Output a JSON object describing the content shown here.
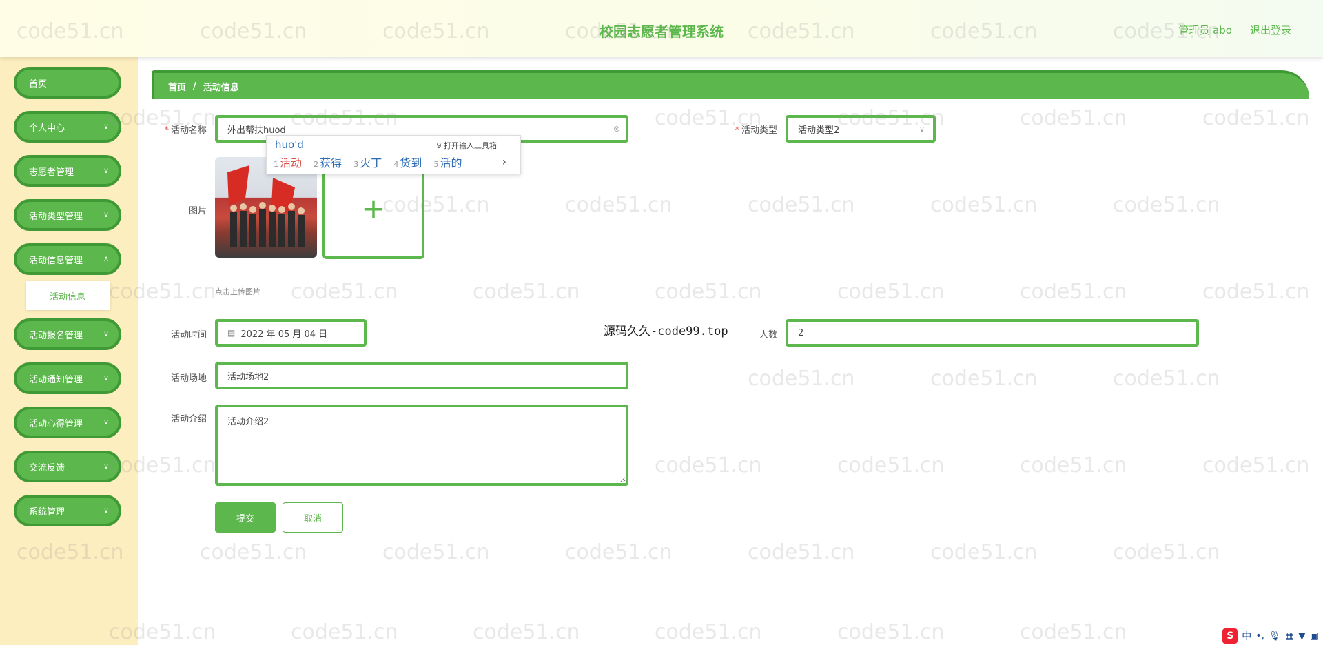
{
  "header": {
    "title": "校园志愿者管理系统",
    "user": "管理员 abo",
    "logout": "退出登录"
  },
  "sidebar": {
    "items": [
      {
        "label": "首页"
      },
      {
        "label": "个人中心"
      },
      {
        "label": "志愿者管理"
      },
      {
        "label": "活动类型管理"
      },
      {
        "label": "活动信息管理"
      },
      {
        "label": "活动报名管理"
      },
      {
        "label": "活动通知管理"
      },
      {
        "label": "活动心得管理"
      },
      {
        "label": "交流反馈"
      },
      {
        "label": "系统管理"
      }
    ],
    "submenu_active": "活动信息"
  },
  "breadcrumb": {
    "home": "首页",
    "separator": "/",
    "current": "活动信息"
  },
  "form": {
    "name_label": "活动名称",
    "name_value": "外出帮扶huod",
    "type_label": "活动类型",
    "type_value": "活动类型2",
    "image_label": "图片",
    "upload_tip": "点击上传图片",
    "time_label": "活动时间",
    "time_value": "2022 年 05 月 04 日",
    "count_label": "人数",
    "count_value": "2",
    "place_label": "活动场地",
    "place_value": "活动场地2",
    "intro_label": "活动介绍",
    "intro_value": "活动介绍2",
    "submit": "提交",
    "cancel": "取消"
  },
  "ime": {
    "typed": "huo'd",
    "toolbox": "9 打开输入工具箱",
    "candidates": [
      {
        "n": "1",
        "text": "活动"
      },
      {
        "n": "2",
        "text": "获得"
      },
      {
        "n": "3",
        "text": "火丁"
      },
      {
        "n": "4",
        "text": "货到"
      },
      {
        "n": "5",
        "text": "活的"
      }
    ]
  },
  "overlay_text": "源码久久-code99.top",
  "watermark": "code51.cn",
  "tray": {
    "ime_badge": "S",
    "lang": "中"
  },
  "colors": {
    "accent": "#5cb84c",
    "accent_dark": "#3f9a35",
    "sidebar_bg": "#fdeebf"
  }
}
